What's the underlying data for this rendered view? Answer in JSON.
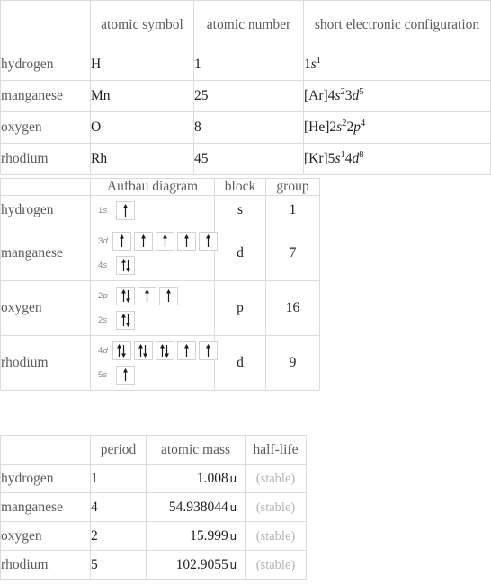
{
  "tables": [
    {
      "id": "properties",
      "name": "element-properties-table",
      "headers": [
        "",
        "atomic symbol",
        "atomic number",
        "short electronic configuration"
      ],
      "rows": [
        {
          "label": "hydrogen",
          "symbol": "H",
          "number": "1",
          "config": [
            {
              "t": "1"
            },
            {
              "t": "s",
              "i": true
            },
            {
              "t": "1",
              "sup": true
            }
          ]
        },
        {
          "label": "manganese",
          "symbol": "Mn",
          "number": "25",
          "config": [
            {
              "t": "[Ar]4"
            },
            {
              "t": "s",
              "i": true
            },
            {
              "t": "2",
              "sup": true
            },
            {
              "t": "3"
            },
            {
              "t": "d",
              "i": true
            },
            {
              "t": "5",
              "sup": true
            }
          ]
        },
        {
          "label": "oxygen",
          "symbol": "O",
          "number": "8",
          "config": [
            {
              "t": "[He]2"
            },
            {
              "t": "s",
              "i": true
            },
            {
              "t": "2",
              "sup": true
            },
            {
              "t": "2"
            },
            {
              "t": "p",
              "i": true
            },
            {
              "t": "4",
              "sup": true
            }
          ]
        },
        {
          "label": "rhodium",
          "symbol": "Rh",
          "number": "45",
          "config": [
            {
              "t": "[Kr]5"
            },
            {
              "t": "s",
              "i": true
            },
            {
              "t": "1",
              "sup": true
            },
            {
              "t": "4"
            },
            {
              "t": "d",
              "i": true
            },
            {
              "t": "8",
              "sup": true
            }
          ]
        }
      ]
    },
    {
      "id": "aufbau",
      "name": "aufbau-diagram-table",
      "headers": [
        "",
        "Aufbau diagram",
        "block",
        "group"
      ],
      "rows": [
        {
          "label": "hydrogen",
          "block": "s",
          "group": "1",
          "shells": [
            {
              "n": "1",
              "orbital": "s",
              "boxes": [
                "up"
              ]
            }
          ]
        },
        {
          "label": "manganese",
          "block": "d",
          "group": "7",
          "shells": [
            {
              "n": "3",
              "orbital": "d",
              "boxes": [
                "up",
                "up",
                "up",
                "up",
                "up"
              ]
            },
            {
              "n": "4",
              "orbital": "s",
              "boxes": [
                "pair"
              ]
            }
          ]
        },
        {
          "label": "oxygen",
          "block": "p",
          "group": "16",
          "shells": [
            {
              "n": "2",
              "orbital": "p",
              "boxes": [
                "pair",
                "up",
                "up"
              ]
            },
            {
              "n": "2",
              "orbital": "s",
              "boxes": [
                "pair"
              ]
            }
          ]
        },
        {
          "label": "rhodium",
          "block": "d",
          "group": "9",
          "shells": [
            {
              "n": "4",
              "orbital": "d",
              "boxes": [
                "pair",
                "pair",
                "pair",
                "up",
                "up"
              ]
            },
            {
              "n": "5",
              "orbital": "s",
              "boxes": [
                "up"
              ]
            }
          ]
        }
      ]
    },
    {
      "id": "misc",
      "name": "element-misc-table",
      "headers": [
        "",
        "period",
        "atomic mass",
        "half-life"
      ],
      "rows": [
        {
          "label": "hydrogen",
          "period": "1",
          "mass": "1.008",
          "unit": "u",
          "halflife": "(stable)"
        },
        {
          "label": "manganese",
          "period": "4",
          "mass": "54.938044",
          "unit": "u",
          "halflife": "(stable)"
        },
        {
          "label": "oxygen",
          "period": "2",
          "mass": "15.999",
          "unit": "u",
          "halflife": "(stable)"
        },
        {
          "label": "rhodium",
          "period": "5",
          "mass": "102.9055",
          "unit": "u",
          "halflife": "(stable)"
        }
      ]
    }
  ],
  "colors": {
    "border": "#dcdcdc",
    "header_text": "#5b5b5b",
    "value_text": "#202020",
    "muted_text": "#b4b4b4",
    "shell_label": "#8a8a8a"
  }
}
